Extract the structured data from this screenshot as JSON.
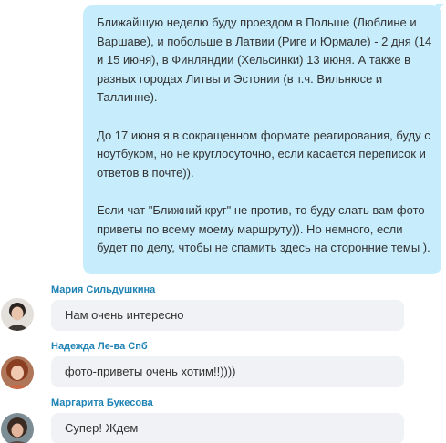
{
  "outgoing": {
    "paragraphs": [
      "Ближайшую неделю буду проездом в Польше (Люблине и Варшаве), и побольше в Латвии (Риге и Юрмале) - 2 дня (14 и 15 июня), в Финляндии (Хельсинки) 13 июня. А также в разных городах Литвы и Эстонии (в т.ч. Вильнюсе и Таллинне).",
      "До 17 июня я в сокращенном формате реагирования, буду с ноутбуком, но не круглосуточно, если касается переписок и ответов в почте)).",
      "Если чат \"Ближний круг\" не против, то буду слать вам фото-приветы по всему моему маршруту)). Но немного, если будет по делу, чтобы не спамить здесь на сторонние темы )."
    ]
  },
  "incoming": [
    {
      "sender": "Мария Сильдушкина",
      "text": "Нам очень интересно"
    },
    {
      "sender": "Надежда Ле-ва Спб",
      "text": "фото-приветы очень хотим!!))))"
    },
    {
      "sender": "Маргарита Букесова",
      "text": "Супер! Ждем"
    }
  ],
  "colors": {
    "outgoing_bubble": "#c7ecfb",
    "incoming_bubble": "#f0f2f5",
    "sender_name": "#1e82b4",
    "text": "#333333"
  }
}
